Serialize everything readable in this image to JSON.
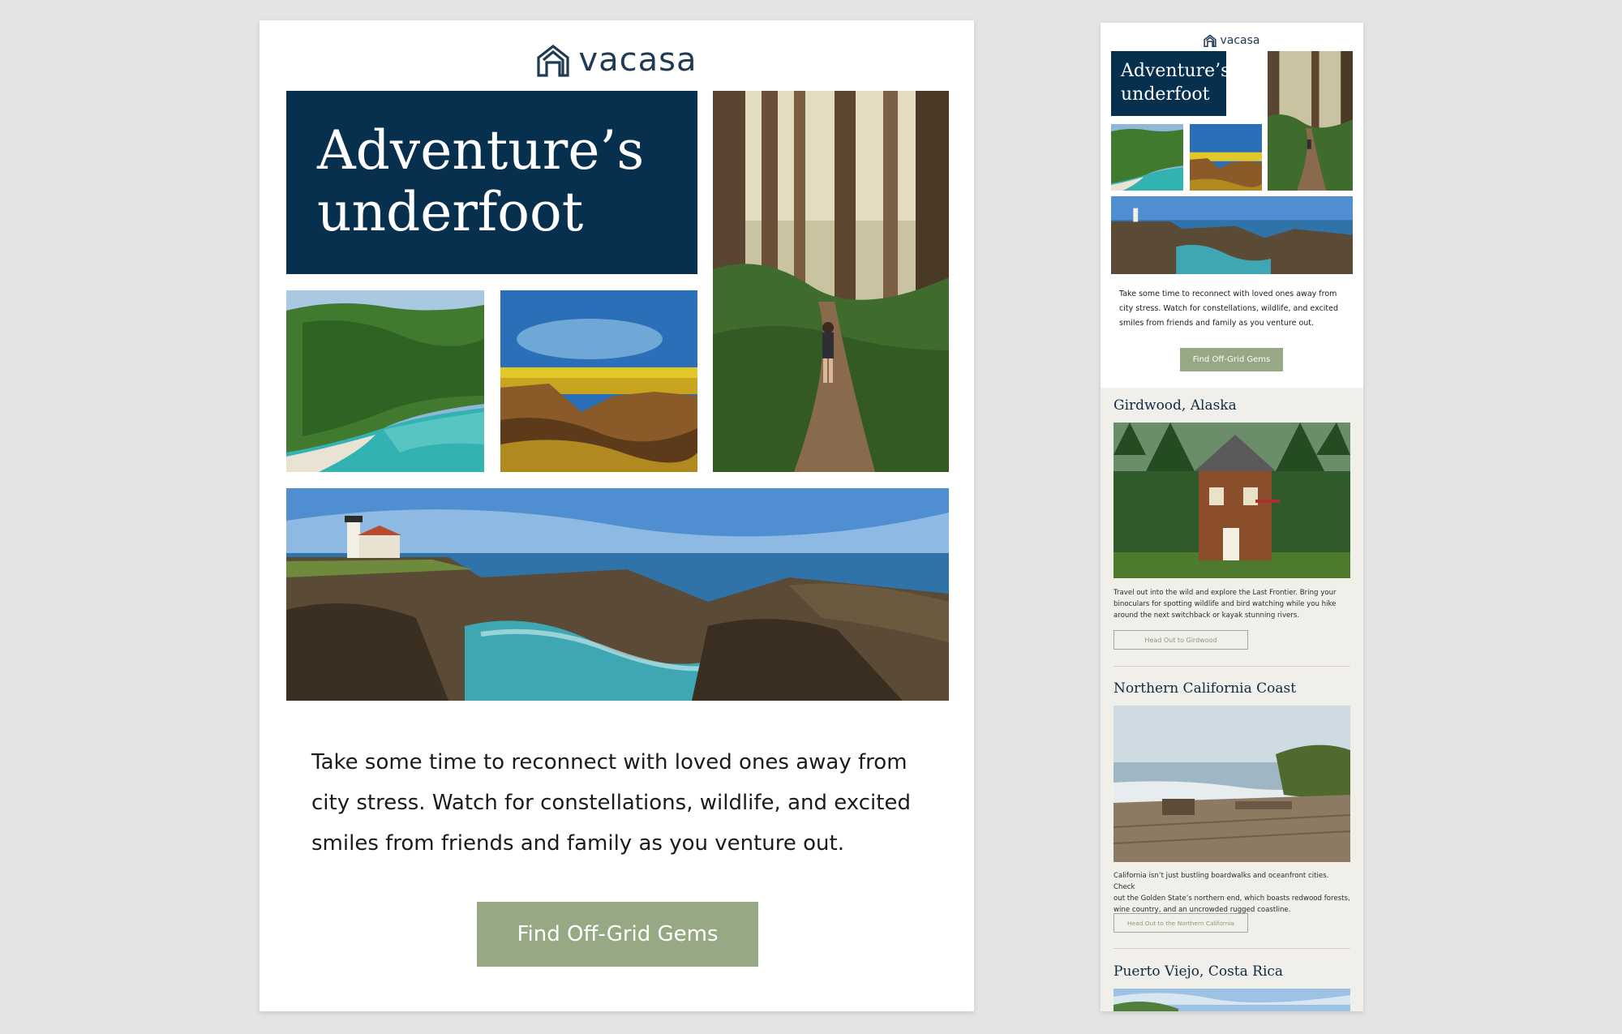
{
  "brand": {
    "name": "vacasa",
    "logo_icon": "house-outline-icon",
    "color": "#1f3a55"
  },
  "hero": {
    "headline_line1": "Adventure’s",
    "headline_line2": "underfoot",
    "box_color": "#072f4e"
  },
  "intro": {
    "line1": "Take some time to reconnect with loved ones away from",
    "line2": "city stress. Watch for constellations, wildlife, and excited",
    "line3": "smiles from friends and family as you venture out."
  },
  "cta": {
    "label": "Find Off-Grid Gems",
    "color": "#97a884"
  },
  "destinations": [
    {
      "title": "Girdwood, Alaska",
      "desc_line1": "Travel out into the wild and explore the Last Frontier. Bring your",
      "desc_line2": "binoculars for spotting wildlife and bird watching while you hike",
      "desc_line3": "around the next switchback or kayak stunning rivers.",
      "button": "Head Out to Girdwood"
    },
    {
      "title": "Northern California Coast",
      "desc_line1": "California isn’t just bustling boardwalks and oceanfront cities. Check",
      "desc_line2": "out the Golden State’s northern end, which boasts redwood forests,",
      "desc_line3": "wine country, and an uncrowded rugged coastline.",
      "button": "Head Out to the Northern California"
    },
    {
      "title": "Puerto Viejo, Costa Rica"
    }
  ],
  "colors": {
    "page_bg": "#e4e4e4",
    "section_bg": "#f1efea",
    "text_dark": "#1b1b1b"
  }
}
